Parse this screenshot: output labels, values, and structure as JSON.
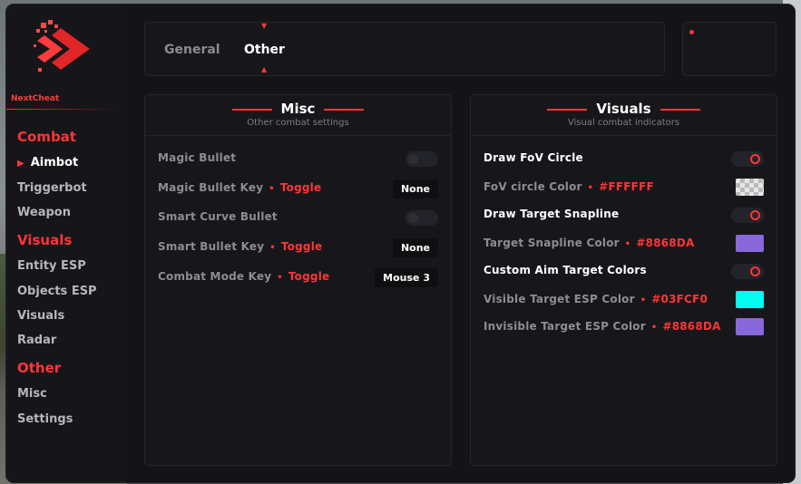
{
  "brand": {
    "name": "NextCheat",
    "accent": "#FF3535"
  },
  "sidebar": {
    "sections": [
      {
        "title": "Combat",
        "items": [
          {
            "label": "Aimbot",
            "active": true
          },
          {
            "label": "Triggerbot"
          },
          {
            "label": "Weapon"
          }
        ]
      },
      {
        "title": "Visuals",
        "items": [
          {
            "label": "Entity ESP"
          },
          {
            "label": "Objects ESP"
          },
          {
            "label": "Visuals"
          },
          {
            "label": "Radar"
          }
        ]
      },
      {
        "title": "Other",
        "items": [
          {
            "label": "Misc"
          },
          {
            "label": "Settings"
          }
        ]
      }
    ]
  },
  "tabs": [
    {
      "label": "General",
      "active": false
    },
    {
      "label": "Other",
      "active": true
    }
  ],
  "misc": {
    "title": "Misc",
    "subtitle": "Other combat settings",
    "rows": [
      {
        "label": "Magic Bullet",
        "control": "switch",
        "on": false
      },
      {
        "label": "Magic Bullet Key",
        "mode": "Toggle",
        "control": "key",
        "key": "None"
      },
      {
        "label": "Smart Curve Bullet",
        "control": "switch",
        "on": false
      },
      {
        "label": "Smart Bullet Key",
        "mode": "Toggle",
        "control": "key",
        "key": "None"
      },
      {
        "label": "Combat Mode Key",
        "mode": "Toggle",
        "control": "key",
        "key": "Mouse 3"
      }
    ]
  },
  "visuals": {
    "title": "Visuals",
    "subtitle": "Visual combat indicators",
    "rows": [
      {
        "label": "Draw FoV Circle",
        "control": "switch",
        "on": true
      },
      {
        "label": "FoV circle Color",
        "value": "#FFFFFF",
        "control": "color",
        "color": "#FFFFFF",
        "checker": true
      },
      {
        "label": "Draw Target Snapline",
        "control": "switch",
        "on": true
      },
      {
        "label": "Target Snapline Color",
        "value": "#8868DA",
        "control": "color",
        "color": "#8868DA"
      },
      {
        "label": "Custom Aim Target Colors",
        "control": "switch",
        "on": true
      },
      {
        "label": "Visible Target ESP Color",
        "value": "#03FCF0",
        "control": "color",
        "color": "#03FCF0"
      },
      {
        "label": "Invisible Target ESP Color",
        "value": "#8868DA",
        "control": "color",
        "color": "#8868DA"
      }
    ]
  }
}
